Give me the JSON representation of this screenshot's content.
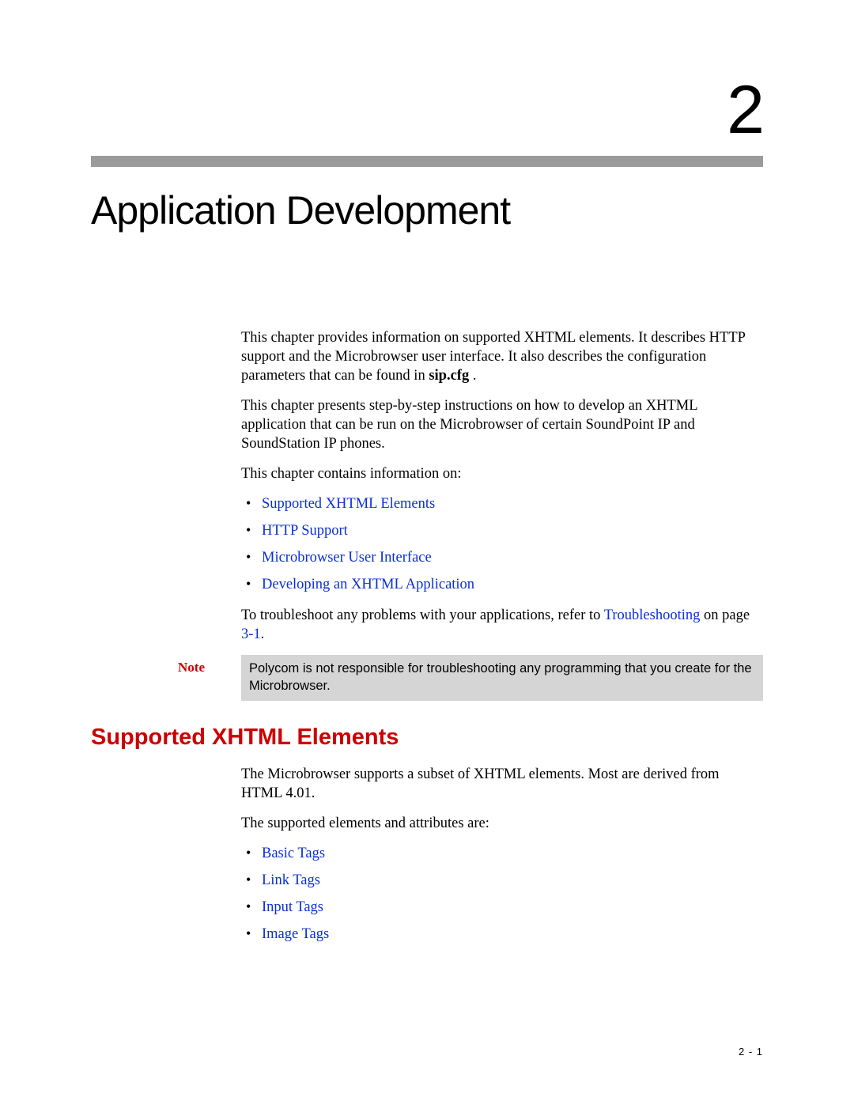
{
  "chapter": {
    "number": "2",
    "title": "Application Development"
  },
  "intro": {
    "p1a": "This chapter provides information on supported XHTML elements. It describes HTTP support and the Microbrowser user interface. It also describes the configuration parameters that can be found in ",
    "p1b": "sip.cfg",
    "p1c": " .",
    "p2": "This chapter presents step-by-step instructions on how to develop an XHTML application that can be run on the Microbrowser of certain SoundPoint IP and SoundStation IP phones.",
    "p3": "This chapter contains information on:",
    "links": [
      "Supported XHTML Elements",
      "HTTP Support",
      "Microbrowser User Interface",
      "Developing an XHTML Application"
    ],
    "p4a": "To troubleshoot any problems with your applications, refer to ",
    "p4link": "Troubleshooting",
    "p4b": " on page ",
    "p4pg": "3-1",
    "p4c": "."
  },
  "note": {
    "label": "Note",
    "text": "Polycom is not responsible for troubleshooting any programming that you create for the Microbrowser."
  },
  "section": {
    "heading": "Supported XHTML Elements",
    "p1": "The Microbrowser supports a subset of XHTML elements. Most are derived from HTML 4.01.",
    "p2": "The supported elements and attributes are:",
    "links": [
      "Basic Tags",
      "Link Tags",
      "Input Tags",
      "Image Tags"
    ]
  },
  "footer": {
    "pagenum": "2 - 1"
  }
}
